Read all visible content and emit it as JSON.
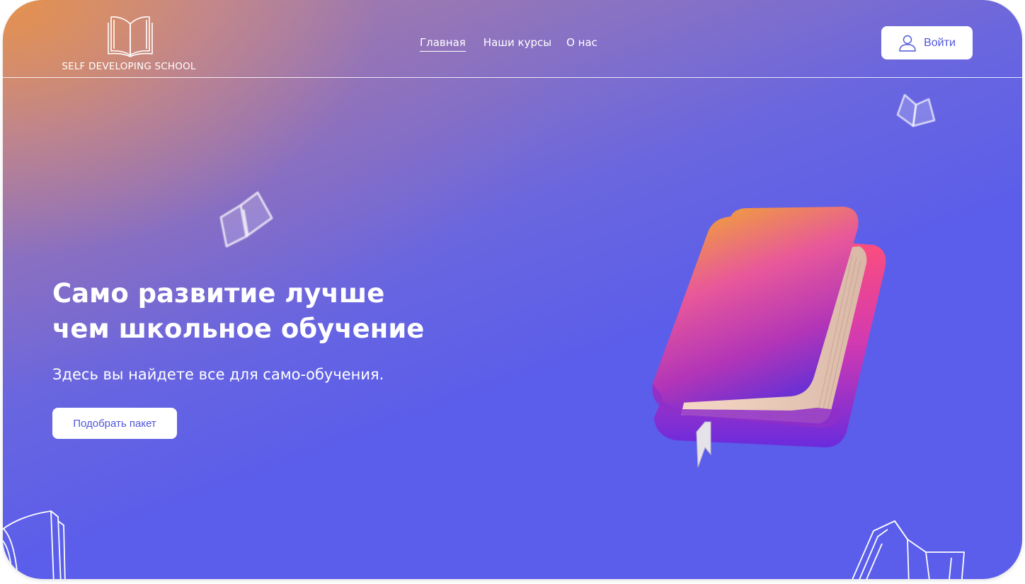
{
  "header": {
    "logo_text": "SELF DEVELOPING SCHOOL",
    "nav": [
      {
        "label": "Главная",
        "active": true
      },
      {
        "label": "Наши курсы",
        "active": false
      },
      {
        "label": "О нас",
        "active": false
      }
    ],
    "login_label": "Войти"
  },
  "hero": {
    "title_line1": "Само развитие лучше",
    "title_line2": "чем школьное обучение",
    "subtitle": "Здесь вы найдете все для само-обучения.",
    "cta_label": "Подобрать пакет"
  },
  "icons": {
    "logo": "open-book-icon",
    "login": "user-icon",
    "decor": [
      "floating-book-icon",
      "floating-book-icon",
      "book-outline-icon",
      "book-outline-icon"
    ],
    "hero_image": "book-3d-illustration"
  },
  "colors": {
    "accent": "#5b5eea",
    "button_text": "#4f55d9",
    "gradient_warm": "#e89248",
    "white": "#ffffff"
  }
}
